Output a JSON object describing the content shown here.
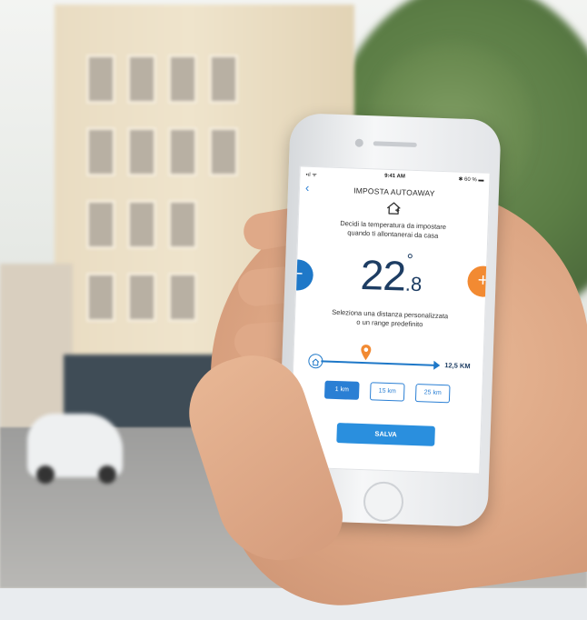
{
  "status_bar": {
    "signal": "•ıl ᯤ",
    "time": "9:41 AM",
    "battery": "✱ 60 % ▬"
  },
  "header": {
    "back_icon": "‹",
    "title": "IMPOSTA AUTOAWAY"
  },
  "description": {
    "line1": "Decidi la temperatura da impostare",
    "line2": "quando ti allontanerai da casa"
  },
  "temperature": {
    "integer": "22",
    "degree": "°",
    "decimal": ".8",
    "minus_symbol": "−",
    "plus_symbol": "+"
  },
  "distance_description": {
    "line1": "Seleziona una distanza personalizzata",
    "line2": "o un range predefinito"
  },
  "distance": {
    "value_label": "12,5 KM"
  },
  "presets": [
    {
      "label": "1 km",
      "active": true
    },
    {
      "label": "15 km",
      "active": false
    },
    {
      "label": "25 km",
      "active": false
    }
  ],
  "save_label": "SALVA",
  "colors": {
    "primary_blue": "#2a7fd4",
    "orange": "#f28a32",
    "temp_text": "#1d3d63"
  },
  "icons": [
    "house-icon",
    "map-pin-icon",
    "home-node-icon",
    "back-chevron-icon",
    "minus-icon",
    "plus-icon"
  ]
}
